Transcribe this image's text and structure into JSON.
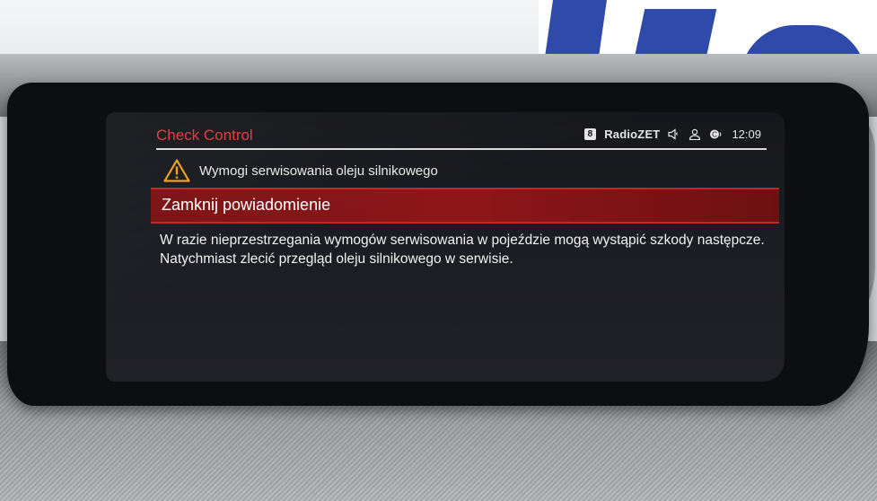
{
  "header": {
    "app_title": "Check Control",
    "preset_number": "8",
    "station_name": "RadioZET",
    "time": "12:09",
    "status_icons": [
      "speaker-icon",
      "person-icon",
      "connectivity-icon"
    ]
  },
  "warning": {
    "icon": "warning-triangle-icon",
    "text": "Wymogi serwisowania oleju silnikowego"
  },
  "menu": {
    "selected_item": "Zamknij powiadomienie"
  },
  "message": {
    "text": "W razie nieprzestrzegania wymogów serwisowania w pojeździe mogą wystąpić szkody następcze. Natychmiast zlecić przegląd oleju silnikowego w serwisie."
  },
  "colors": {
    "accent_red": "#e23a3a",
    "highlight_red": "#8e1618",
    "warning_orange": "#f0a020"
  }
}
